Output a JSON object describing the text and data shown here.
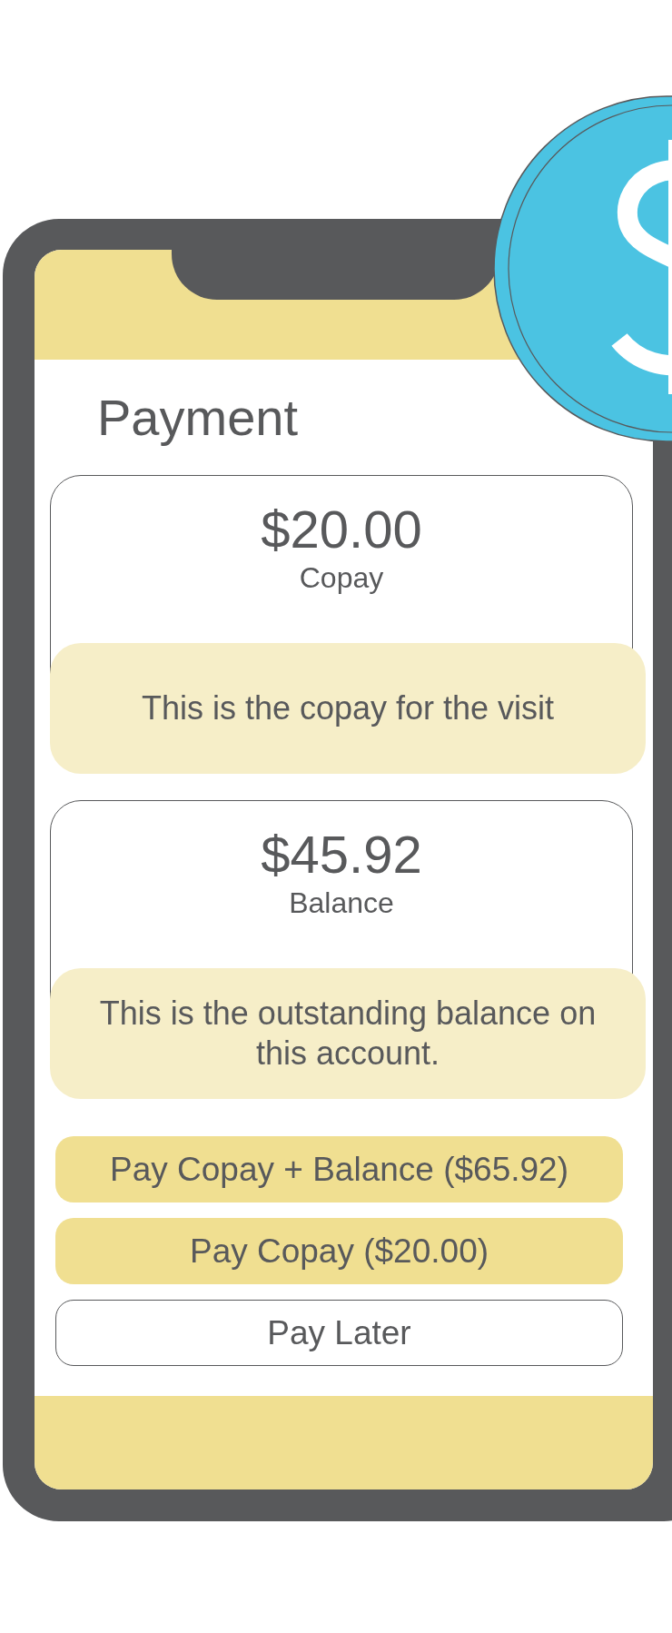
{
  "title": "Payment",
  "cards": [
    {
      "amount": "$20.00",
      "label": "Copay",
      "note": "This is the copay for the visit"
    },
    {
      "amount": "$45.92",
      "label": "Balance",
      "note": "This is the outstanding balance on this account."
    }
  ],
  "buttons": [
    {
      "label": "Pay Copay + Balance ($65.92)",
      "kind": "filled"
    },
    {
      "label": "Pay Copay ($20.00)",
      "kind": "filled"
    },
    {
      "label": "Pay Later",
      "kind": "outline"
    }
  ]
}
